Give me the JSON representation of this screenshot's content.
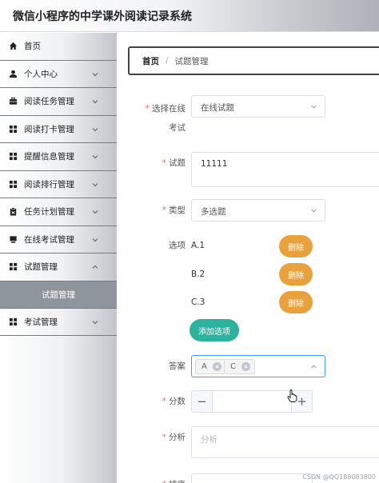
{
  "app": {
    "title": "微信小程序的中学课外阅读记录系统"
  },
  "sidebar": {
    "items": [
      {
        "label": "首页",
        "icon": "home-icon",
        "expandable": false
      },
      {
        "label": "个人中心",
        "icon": "user-icon",
        "expandable": true
      },
      {
        "label": "阅读任务管理",
        "icon": "briefcase-icon",
        "expandable": true
      },
      {
        "label": "阅读打卡管理",
        "icon": "grid-icon",
        "expandable": true
      },
      {
        "label": "提醒信息管理",
        "icon": "grid-icon",
        "expandable": true
      },
      {
        "label": "阅读排行管理",
        "icon": "grid-icon",
        "expandable": true
      },
      {
        "label": "任务计划管理",
        "icon": "clipboard-icon",
        "expandable": true
      },
      {
        "label": "在线考试管理",
        "icon": "monitor-icon",
        "expandable": true
      },
      {
        "label": "试题管理",
        "icon": "grid-icon",
        "expandable": true
      }
    ],
    "subitem_active": "试题管理",
    "item_exam": {
      "label": "考试管理",
      "icon": "grid-icon"
    }
  },
  "breadcrumb": {
    "home": "首页",
    "separator": "/",
    "current": "试题管理"
  },
  "form": {
    "exam": {
      "label_line1": "选择在线",
      "label_line2": "考试",
      "value": "在线试题"
    },
    "question": {
      "label": "试题",
      "value": "11111"
    },
    "type": {
      "label": "类型",
      "value": "多选题"
    },
    "options": {
      "label": "选项",
      "items": [
        "A.1",
        "B.2",
        "C.3"
      ],
      "delete_label": "删除",
      "add_label": "添加选项"
    },
    "answer": {
      "label": "答案",
      "tags": [
        "A",
        "C"
      ]
    },
    "score": {
      "label": "分数",
      "minus": "−",
      "plus": "+"
    },
    "analysis": {
      "label": "分析",
      "placeholder": "分析"
    },
    "sort": {
      "label": "排序"
    }
  },
  "watermark": "CSDN @QQ188083800",
  "colors": {
    "delete": "#e9a23b",
    "add": "#2bb39e",
    "required": "#f56c6c",
    "active_sub": "#8f959c"
  }
}
